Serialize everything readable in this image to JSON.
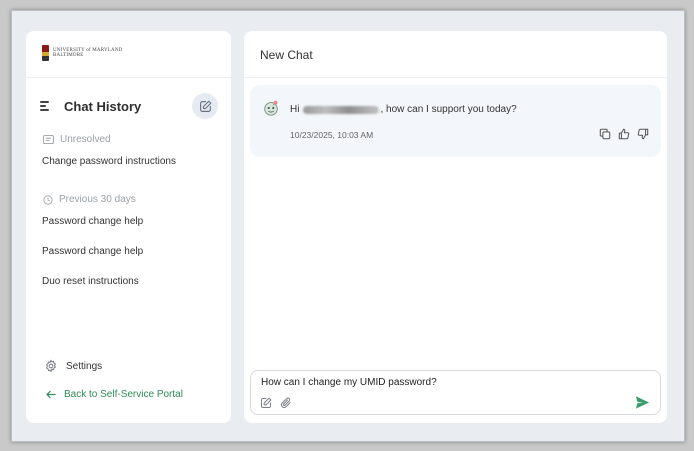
{
  "sidebar": {
    "logo": {
      "line1": "UNIVERSITY of MARYLAND",
      "line2": "BALTIMORE"
    },
    "header_title": "Chat History",
    "sections": [
      {
        "label": "Unresolved",
        "items": [
          "Change password instructions"
        ]
      },
      {
        "label": "Previous 30 days",
        "items": [
          "Password change help",
          "Password change help",
          "Duo reset instructions"
        ]
      }
    ],
    "settings_label": "Settings",
    "back_label": "Back to Self-Service Portal"
  },
  "main": {
    "title": "New Chat",
    "message": {
      "greeting_prefix": "Hi",
      "greeting_suffix": ", how can I support you today?",
      "timestamp": "10/23/2025, 10:03 AM"
    },
    "composer": {
      "value": "How can I change my UMID password?",
      "placeholder": ""
    }
  },
  "colors": {
    "accent_green": "#2e8b57",
    "send_green": "#3a9d6a",
    "panel_bg": "#e9edf2"
  }
}
